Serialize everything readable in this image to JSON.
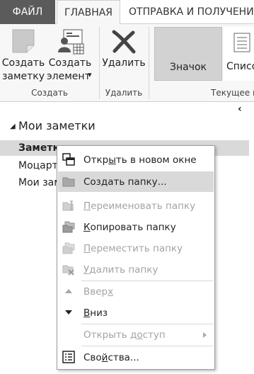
{
  "tabs": {
    "file": "ФАЙЛ",
    "home": "ГЛАВНАЯ",
    "send": "ОТПРАВКА И ПОЛУЧЕНИЕ"
  },
  "ribbon": {
    "new_note": {
      "line1": "Создать",
      "line2": "заметку"
    },
    "new_item": {
      "line1": "Создать",
      "line2": "элемент",
      "arrow": "▾"
    },
    "group_create": "Создать",
    "delete": "Удалить",
    "group_delete": "Удалить",
    "view_icon": "Значок",
    "view_list": "Список",
    "group_current_view": "Текущее п"
  },
  "pane": {
    "collapse": "‹",
    "title": "Мои заметки",
    "items": [
      "Заметки",
      "Моцарт",
      "Мои заметки"
    ]
  },
  "menu": {
    "open_new_window": {
      "pre": "Откр",
      "ul": "ы",
      "post": "ть в новом окне"
    },
    "create_folder": {
      "pre": "Соз",
      "ul": "д",
      "post": "ать папку..."
    },
    "rename_folder": {
      "pre": "",
      "ul": "П",
      "post": "ереименовать папку"
    },
    "copy_folder": {
      "pre": "",
      "ul": "К",
      "post": "опировать папку"
    },
    "move_folder": {
      "pre": "",
      "ul": "П",
      "post": "ереместить папку"
    },
    "delete_folder": {
      "pre": "",
      "ul": "У",
      "post": "далить папку"
    },
    "up": {
      "pre": "Ввер",
      "ul": "х",
      "post": ""
    },
    "down": {
      "pre": "",
      "ul": "В",
      "post": "низ"
    },
    "share": {
      "pre": "Открыть д",
      "ul": "о",
      "post": "ступ"
    },
    "properties": {
      "pre": "Сво",
      "ul": "й",
      "post": "ства..."
    }
  },
  "colors": {
    "file_tab": "#5b5b5b",
    "ribbon_bg": "#f7f7f7",
    "hover": "#d9d9d9",
    "disabled_text": "#a3a3a3"
  }
}
